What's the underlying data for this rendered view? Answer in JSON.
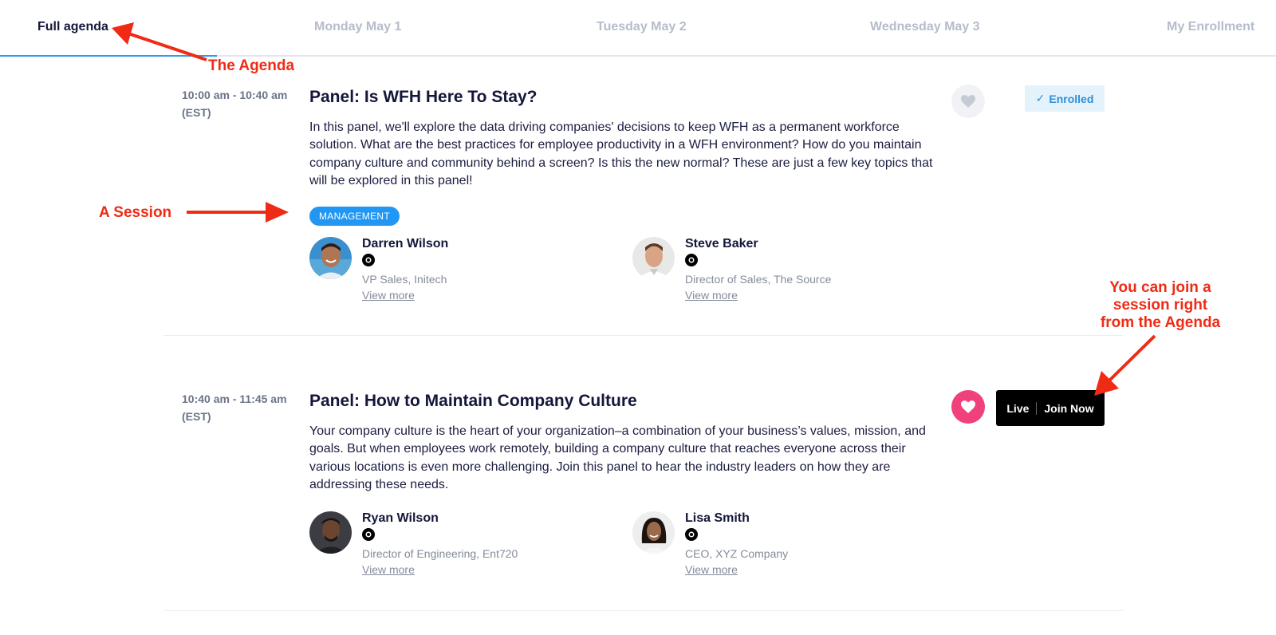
{
  "tabs": [
    {
      "label": "Full agenda",
      "active": true
    },
    {
      "label": "Monday May 1",
      "active": false
    },
    {
      "label": "Tuesday May 2",
      "active": false
    },
    {
      "label": "Wednesday May 3",
      "active": false
    },
    {
      "label": "My Enrollment",
      "active": false
    }
  ],
  "sessions": [
    {
      "time": "10:00 am - 10:40 am",
      "timezone": "(EST)",
      "title": "Panel: Is WFH Here To Stay?",
      "description": "In this panel, we'll explore the data driving companies' decisions to keep WFH as a permanent workforce solution. What are the best practices for employee productivity in a WFH environment? How do you maintain company culture and community behind a screen? Is this the new normal? These are just a few key topics that will be explored in this panel!",
      "tag": "MANAGEMENT",
      "favorited": false,
      "status_label": "Enrolled",
      "speakers": [
        {
          "name": "Darren Wilson",
          "role": "VP Sales, Initech",
          "more": "View more"
        },
        {
          "name": "Steve Baker",
          "role": "Director of Sales, The Source",
          "more": "View more"
        }
      ]
    },
    {
      "time": "10:40 am - 11:45 am",
      "timezone": "(EST)",
      "title": "Panel: How to Maintain Company Culture",
      "description": "Your company culture is the heart of your organization–a combination of your business’s values, mission, and goals. But when employees work remotely, building a company culture that reaches everyone across their various locations is even more challenging. Join this panel to hear the industry leaders on how they are addressing these needs.",
      "favorited": true,
      "live_label": "Live",
      "join_label": "Join Now",
      "speakers": [
        {
          "name": "Ryan Wilson",
          "role": "Director of Engineering, Ent720",
          "more": "View more"
        },
        {
          "name": "Lisa Smith",
          "role": "CEO, XYZ Company",
          "more": "View more"
        }
      ]
    }
  ],
  "annotations": {
    "agenda": "The Agenda",
    "session": "A Session",
    "join_line1": "You can join a",
    "join_line2": "session right",
    "join_line3": "from the Agenda"
  },
  "colors": {
    "accent": "#2196f3",
    "favorite": "#f0417a",
    "annotation": "#ef2b15"
  }
}
